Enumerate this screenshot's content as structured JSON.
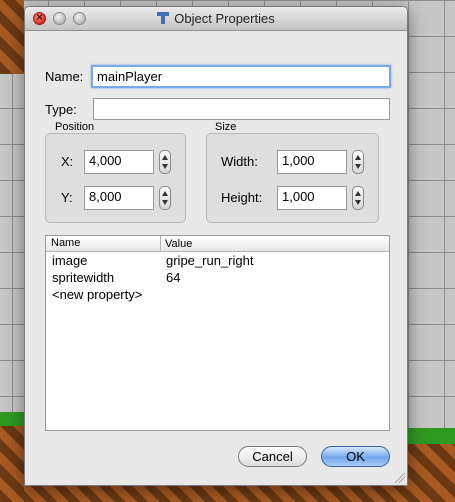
{
  "window": {
    "title": "Object Properties"
  },
  "name_field": {
    "label": "Name:",
    "value": "mainPlayer"
  },
  "type_field": {
    "label": "Type:",
    "value": ""
  },
  "position": {
    "title": "Position",
    "x_label": "X:",
    "x_value": "4,000",
    "y_label": "Y:",
    "y_value": "8,000"
  },
  "size": {
    "title": "Size",
    "width_label": "Width:",
    "width_value": "1,000",
    "height_label": "Height:",
    "height_value": "1,000"
  },
  "properties": {
    "headers": [
      "Name",
      "Value"
    ],
    "rows": [
      {
        "name": "image",
        "value": "gripe_run_right"
      },
      {
        "name": "spritewidth",
        "value": "64"
      },
      {
        "name": "<new property>",
        "value": ""
      }
    ]
  },
  "buttons": {
    "cancel": "Cancel",
    "ok": "OK"
  }
}
